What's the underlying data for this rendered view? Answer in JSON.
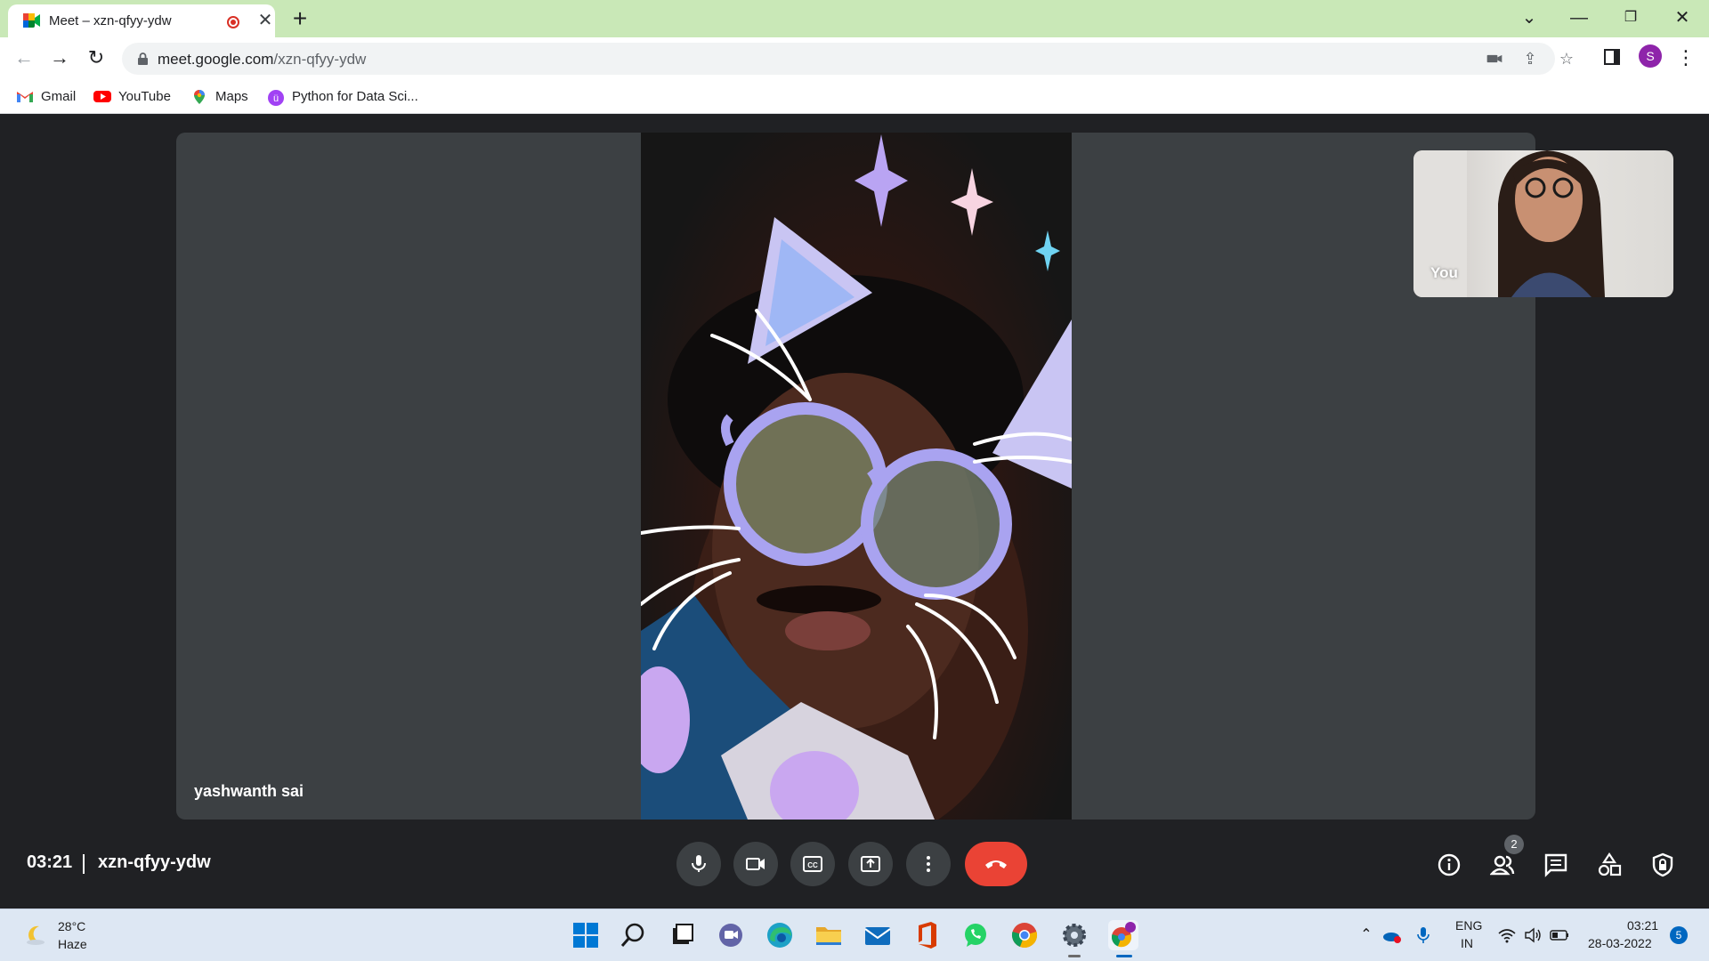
{
  "browser": {
    "tab_title": "Meet – xzn-qfyy-ydw",
    "url_host": "meet.google.com",
    "url_path": "/xzn-qfyy-ydw",
    "profile_initial": "S",
    "bookmarks": [
      {
        "label": "Gmail",
        "icon": "gmail-icon"
      },
      {
        "label": "YouTube",
        "icon": "youtube-icon"
      },
      {
        "label": "Maps",
        "icon": "maps-icon"
      },
      {
        "label": "Python for Data Sci...",
        "icon": "course-icon"
      }
    ]
  },
  "meet": {
    "participant_name": "yashwanth sai",
    "self_label": "You",
    "clock": "03:21",
    "meeting_code": "xzn-qfyy-ydw",
    "participant_count": "2",
    "controls": [
      "microphone-icon",
      "camera-icon",
      "captions-icon",
      "present-icon",
      "more-options-icon",
      "hang-up-icon"
    ],
    "right_controls": [
      "info-icon",
      "people-icon",
      "chat-icon",
      "activities-icon",
      "host-controls-icon"
    ],
    "colors": {
      "hangup": "#ea4335",
      "control_bg": "#3c4043",
      "stage_bg": "#202124"
    }
  },
  "taskbar": {
    "weather_temp": "28°C",
    "weather_desc": "Haze",
    "lang_line1": "ENG",
    "lang_line2": "IN",
    "time": "03:21",
    "date": "28-03-2022",
    "notification_count": "5",
    "apps": [
      "start-icon",
      "search-icon",
      "task-view-icon",
      "teams-chat-icon",
      "edge-icon",
      "file-explorer-icon",
      "mail-icon",
      "office-icon",
      "whatsapp-icon",
      "chrome-icon",
      "settings-icon",
      "chrome-profile-icon"
    ]
  }
}
